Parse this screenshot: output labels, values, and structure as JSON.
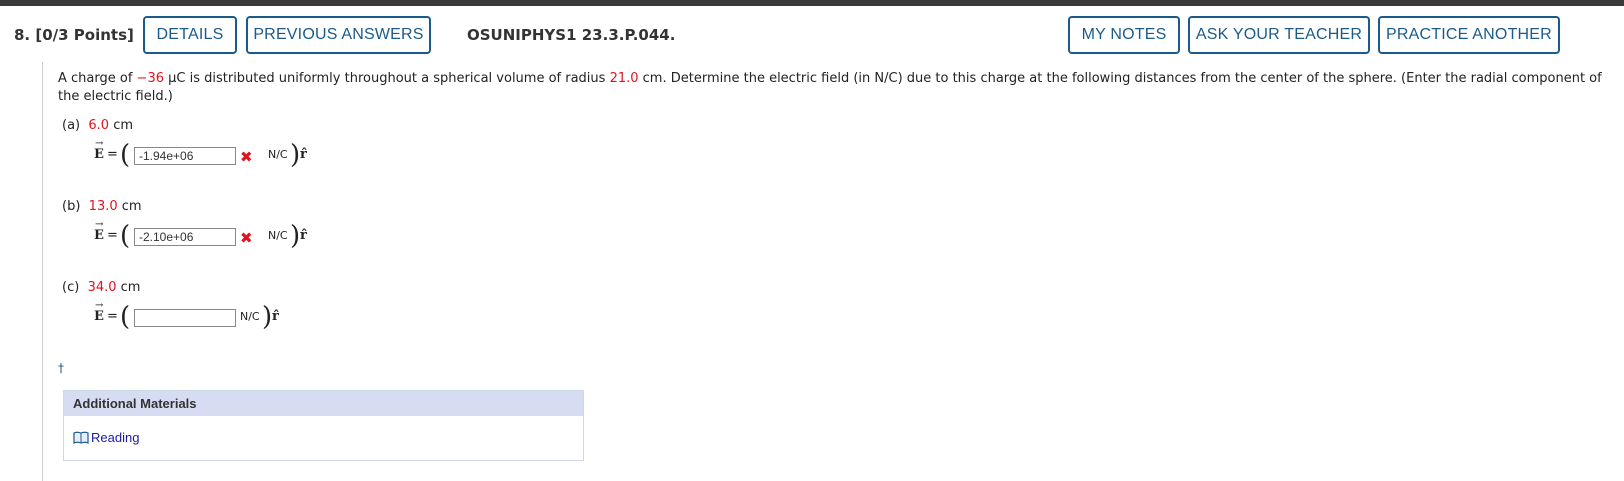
{
  "header": {
    "question_number": "8.",
    "points": "[0/3 Points]",
    "details_label": "DETAILS",
    "previous_answers_label": "PREVIOUS ANSWERS",
    "problem_code": "OSUNIPHYS1 23.3.P.044.",
    "my_notes_label": "MY NOTES",
    "ask_teacher_label": "ASK YOUR TEACHER",
    "practice_another_label": "PRACTICE ANOTHER"
  },
  "question": {
    "text_1": "A charge of ",
    "charge": "−36",
    "text_2": " µC is distributed uniformly throughout a spherical volume of radius ",
    "radius": "21.0",
    "text_3": " cm. Determine the electric field (in N/C) due to this charge at the following distances from the center of the sphere. (Enter the radial component of the electric field.)"
  },
  "parts": [
    {
      "label": "(a)",
      "distance": "6.0",
      "unit": "cm",
      "vector": "E",
      "equals": "=",
      "answer": "-1.94e+06",
      "status": "incorrect",
      "field_unit": "N/C",
      "rhat": "r̂"
    },
    {
      "label": "(b)",
      "distance": "13.0",
      "unit": "cm",
      "vector": "E",
      "equals": "=",
      "answer": "-2.10e+06",
      "status": "incorrect",
      "field_unit": "N/C",
      "rhat": "r̂"
    },
    {
      "label": "(c)",
      "distance": "34.0",
      "unit": "cm",
      "vector": "E",
      "equals": "=",
      "answer": "",
      "status": "unanswered",
      "field_unit": "N/C",
      "rhat": "r̂"
    }
  ],
  "marks": {
    "incorrect": "✖",
    "dagger": "†"
  },
  "additional_materials": {
    "title": "Additional Materials",
    "link_label": "Reading",
    "link_icon": "book-icon"
  },
  "colors": {
    "accent": "#1a5b8c",
    "given_value": "#e0141e",
    "panel_header": "#d6dcf2"
  }
}
